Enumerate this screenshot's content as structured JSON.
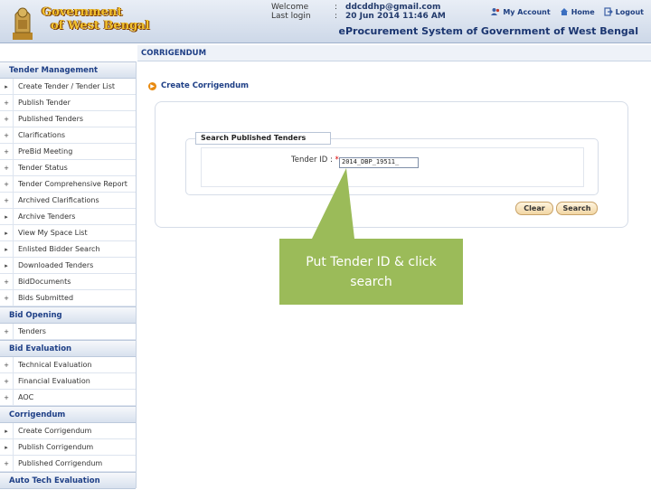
{
  "header": {
    "logo_line1": "Government",
    "logo_line2": "of West Bengal",
    "welcome_label": "Welcome",
    "welcome_value": "ddcddhp@gmail.com",
    "last_login_label": "Last login",
    "last_login_value": "20 Jun 2014 11:46 AM",
    "separator": ":",
    "my_account": "My Account",
    "home": "Home",
    "logout": "Logout",
    "system_title": "eProcurement System of Government of West Bengal"
  },
  "breadcrumb": "CORRIGENDUM",
  "main": {
    "create_title": "Create Corrigendum",
    "legend": "Search Published Tenders",
    "tender_id_label": "Tender ID",
    "tender_id_required": "*",
    "tender_id_value": "2014_DBP_19511_",
    "clear_label": "Clear",
    "search_label": "Search"
  },
  "sidebar": {
    "tender_management": "Tender Management",
    "tm_items": [
      "Create Tender / Tender List",
      "Publish Tender",
      "Published Tenders",
      "Clarifications",
      "PreBid Meeting",
      "Tender Status",
      "Tender Comprehensive Report",
      "Archived Clarifications",
      "Archive Tenders",
      "View My Space List",
      "Enlisted Bidder Search",
      "Downloaded Tenders",
      "BidDocuments",
      "Bids Submitted"
    ],
    "bid_opening": "Bid Opening",
    "bo_items": [
      "Tenders"
    ],
    "bid_evaluation": "Bid Evaluation",
    "be_items": [
      "Technical Evaluation",
      "Financial Evaluation",
      "AOC"
    ],
    "corrigendum": "Corrigendum",
    "co_items": [
      "Create Corrigendum",
      "Publish Corrigendum",
      "Published Corrigendum"
    ],
    "auto_tech": "Auto Tech Evaluation"
  },
  "callout": {
    "line1": "Put Tender ID & click",
    "line2": "search",
    "color": "#9bbb59"
  }
}
